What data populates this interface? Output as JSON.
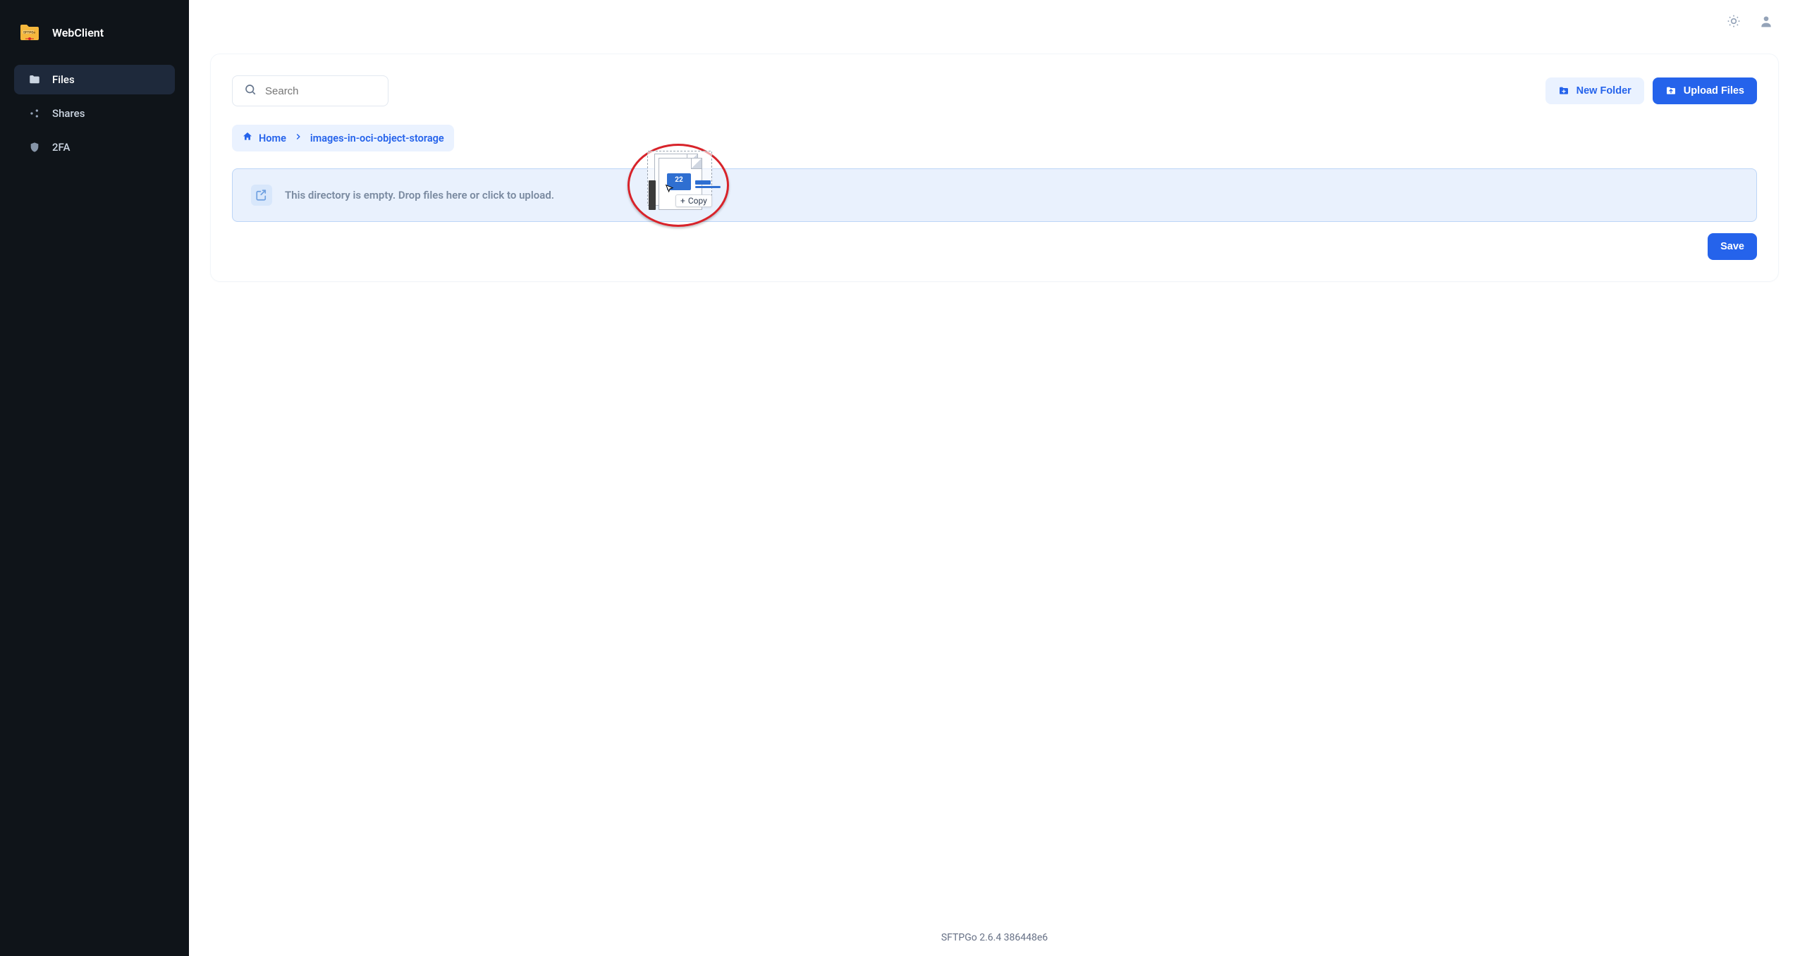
{
  "app": {
    "title": "WebClient",
    "logo_text": "SFTPGo"
  },
  "sidebar": {
    "items": [
      {
        "label": "Files",
        "icon": "folder-icon",
        "active": true
      },
      {
        "label": "Shares",
        "icon": "share-icon",
        "active": false
      },
      {
        "label": "2FA",
        "icon": "shield-icon",
        "active": false
      }
    ]
  },
  "topbar": {
    "theme_toggle": "theme-toggle",
    "user_menu": "user-menu"
  },
  "toolbar": {
    "search_placeholder": "Search",
    "new_folder_label": "New Folder",
    "upload_files_label": "Upload Files"
  },
  "breadcrumb": {
    "home_label": "Home",
    "current_label": "images-in-oci-object-storage"
  },
  "dropzone": {
    "message": "This directory is empty. Drop files here or click to upload."
  },
  "drag_overlay": {
    "badge_count": "22",
    "tooltip": "Copy",
    "tooltip_prefix": "+"
  },
  "actions": {
    "save_label": "Save"
  },
  "footer": {
    "text": "SFTPGo 2.6.4 386448e6"
  },
  "colors": {
    "primary": "#2563eb",
    "sidebar_bg": "#0f1419",
    "highlight_red": "#d8232a"
  }
}
